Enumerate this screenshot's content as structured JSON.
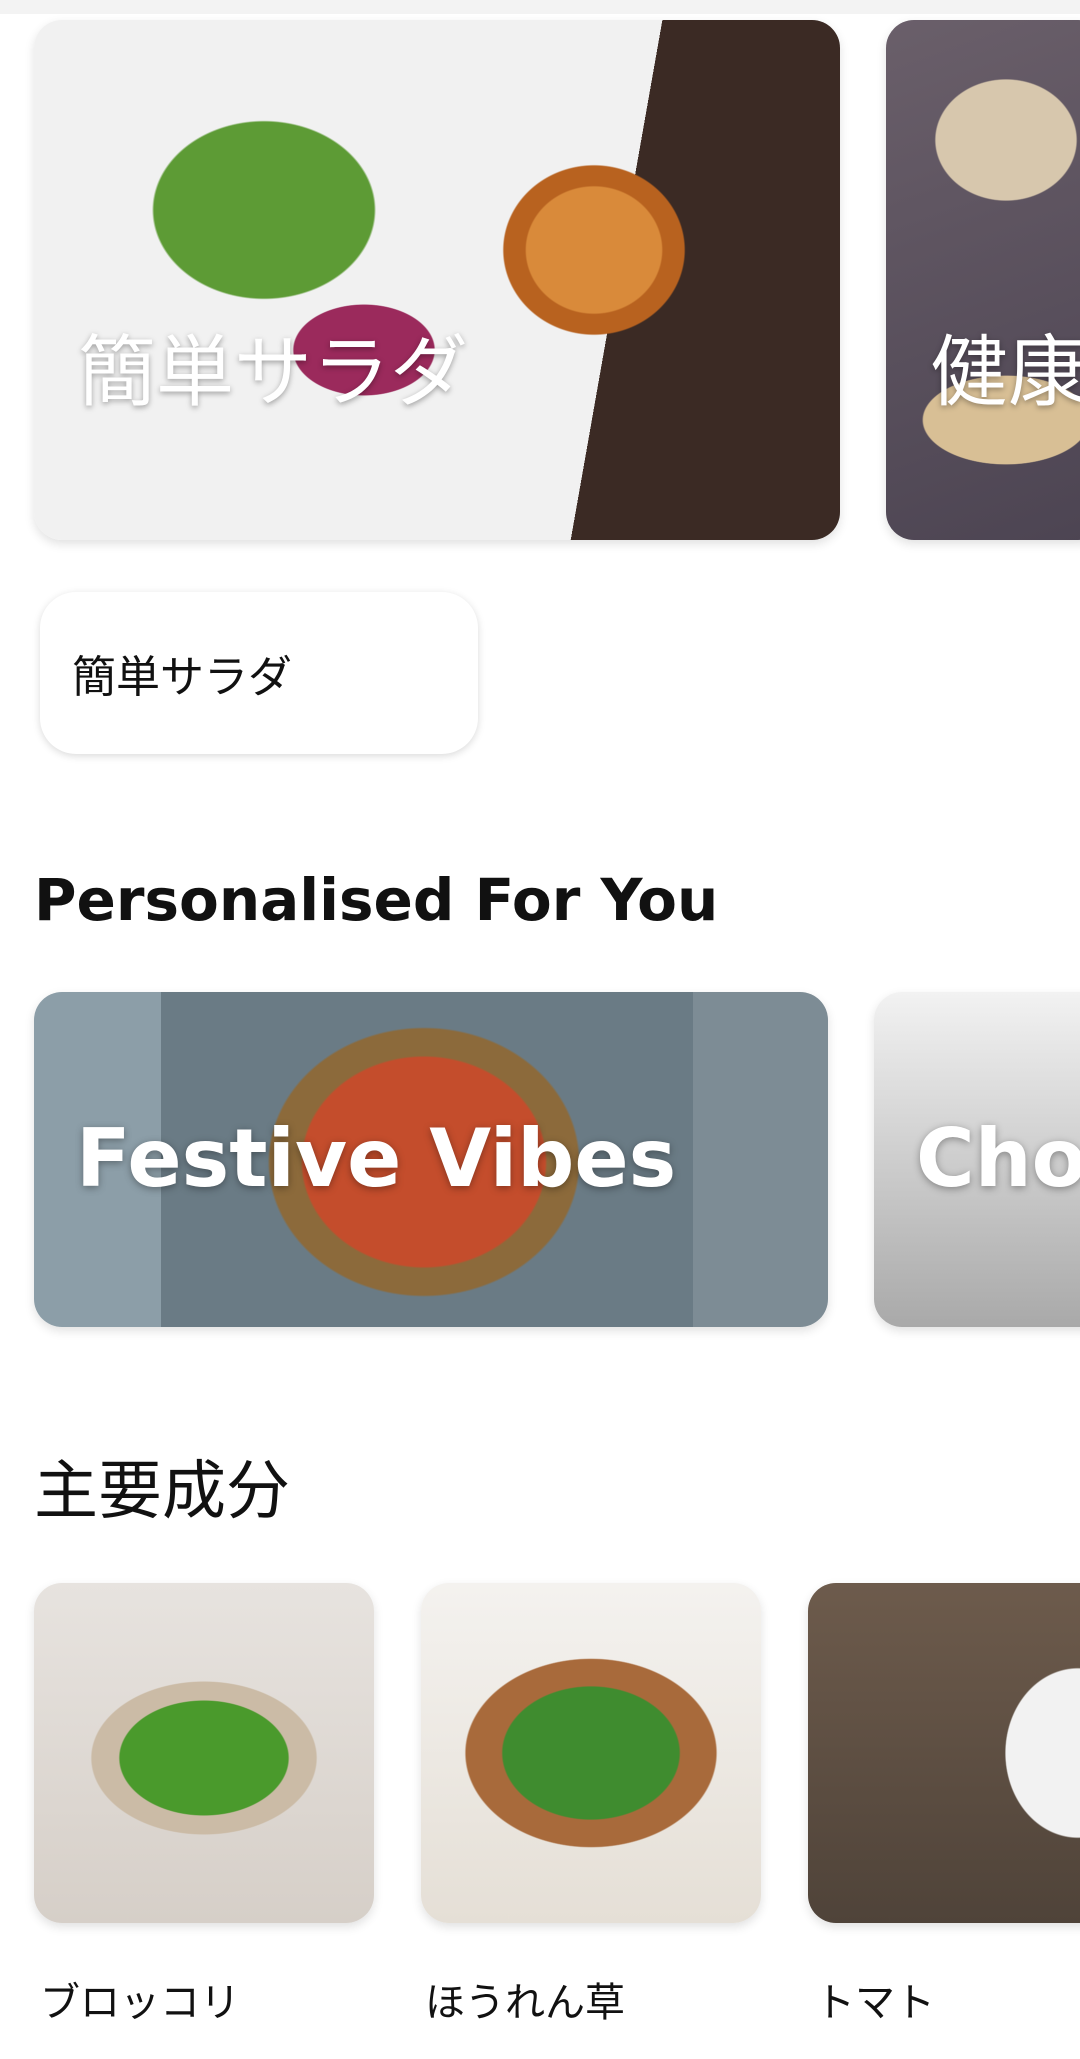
{
  "featured": {
    "cards": [
      {
        "title": "簡単サラダ"
      },
      {
        "title": "健康"
      }
    ]
  },
  "selected_chip": {
    "label": "簡単サラダ"
  },
  "personalised": {
    "title": "Personalised For You",
    "cards": [
      {
        "title": "Festive Vibes"
      },
      {
        "title": "Choc"
      }
    ]
  },
  "main_ingredients": {
    "title": "主要成分",
    "items": [
      {
        "label": "ブロッコリ"
      },
      {
        "label": "ほうれん草"
      },
      {
        "label": "トマト"
      }
    ]
  }
}
